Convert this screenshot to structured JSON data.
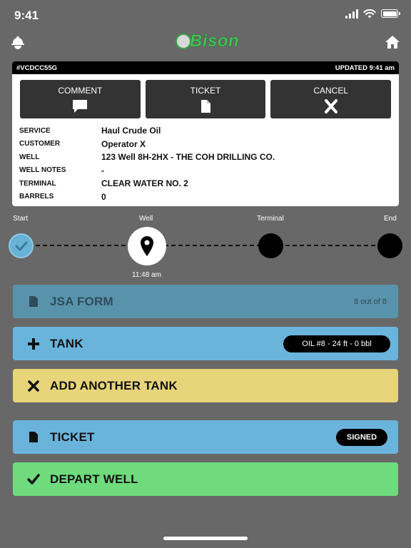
{
  "status": {
    "time": "9:41"
  },
  "header": {
    "logo_text": "Bison"
  },
  "card": {
    "id": "#VCDCC55G",
    "updated": "UPDATED 9:41 am",
    "actions": [
      {
        "label": "COMMENT",
        "icon": "comment-icon"
      },
      {
        "label": "TICKET",
        "icon": "document-icon"
      },
      {
        "label": "CANCEL",
        "icon": "x-icon"
      }
    ],
    "info": [
      {
        "key": "SERVICE",
        "value": "Haul Crude Oil"
      },
      {
        "key": "CUSTOMER",
        "value": "Operator X"
      },
      {
        "key": "WELL",
        "value": "123 Well 8H-2HX - THE COH DRILLING CO."
      },
      {
        "key": "WELL NOTES",
        "value": "-"
      },
      {
        "key": "TERMINAL",
        "value": "CLEAR WATER NO. 2"
      },
      {
        "key": "BARRELS",
        "value": "0"
      }
    ]
  },
  "progress": {
    "steps": [
      {
        "label": "Start",
        "state": "done"
      },
      {
        "label": "Well",
        "state": "current"
      },
      {
        "label": "Terminal",
        "state": "pending"
      },
      {
        "label": "End",
        "state": "pending"
      }
    ],
    "well_time": "11:48 am"
  },
  "bars": {
    "jsa": {
      "label": "JSA FORM",
      "count": "8 out of 8"
    },
    "tank": {
      "label": "TANK",
      "pill": "OIL #8 - 24 ft - 0 bbl"
    },
    "add_tank": {
      "label": "ADD ANOTHER TANK"
    },
    "ticket": {
      "label": "TICKET",
      "pill": "SIGNED"
    },
    "depart": {
      "label": "DEPART WELL"
    }
  },
  "colors": {
    "background": "#686868",
    "blue": "#6ab4dc",
    "yellow": "#e7d47b",
    "green": "#6fdb7d",
    "brand_green": "#47c15a"
  }
}
